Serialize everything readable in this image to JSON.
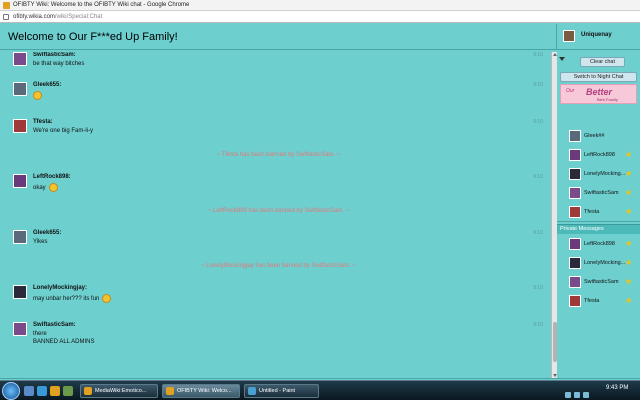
{
  "browser": {
    "window_title": "OFIBTY Wiki: Welcome to the OFIBTY Wiki chat - Google Chrome",
    "url_domain": "ofibty.wikia.com",
    "url_path": "/wiki/Special:Chat"
  },
  "chat": {
    "room_title": "Welcome to Our F***ed Up Family!",
    "current_user": "Uniquenay",
    "messages": [
      {
        "user": "SwiftasticSam:",
        "lines": [
          "be that way bitches"
        ],
        "time": "9:10",
        "avatar_color": "#7a4a8a"
      },
      {
        "user": "Gleek655:",
        "lines": [
          ""
        ],
        "time": "9:10",
        "avatar_color": "#5a6a7a",
        "emote": "smiley"
      },
      {
        "user": "Tfesta:",
        "lines": [
          "We're one big Fam-li-y"
        ],
        "time": "9:10",
        "avatar_color": "#a03a3a"
      },
      {
        "user": "LeftRock898:",
        "lines": [
          "okay"
        ],
        "time": "9:10",
        "avatar_color": "#6a3a7a",
        "emote": "smiley"
      },
      {
        "user": "Gleek655:",
        "lines": [
          "Yikes"
        ],
        "time": "9:10",
        "avatar_color": "#5a6a7a"
      },
      {
        "user": "LonelyMockingjay:",
        "lines": [
          "may unbar her??? its fun"
        ],
        "time": "9:10",
        "avatar_color": "#2a2a3a",
        "emote": "smiley"
      },
      {
        "user": "SwiftasticSam:",
        "lines": [
          "there",
          "BANNED ALL ADMINS"
        ],
        "time": "9:10",
        "avatar_color": "#7a4a8a"
      }
    ],
    "inline_alerts": [
      "~ Tfesta has been banned by SwiftasticSam. ~",
      "~ LeftRock898 has been banned by SwiftasticSam. ~",
      "~ LonelyMockingjay has been banned by SwiftasticSam. ~"
    ]
  },
  "sidebar": {
    "clear_chat_label": "Clear chat",
    "night_chat_label": "Switch to Night Chat",
    "banner": {
      "line1": "Our",
      "line2": "Better",
      "line3": "Bleh Family"
    },
    "users": [
      {
        "name": "Gleek##",
        "star": false,
        "avatar_color": "#5a6a7a"
      },
      {
        "name": "LeftRock898",
        "star": true,
        "avatar_color": "#6a3a7a"
      },
      {
        "name": "LonelyMocking...",
        "star": true,
        "avatar_color": "#2a2a3a"
      },
      {
        "name": "SwiftasticSam",
        "star": true,
        "avatar_color": "#7a4a8a"
      },
      {
        "name": "Tfesta",
        "star": true,
        "avatar_color": "#a03a3a"
      }
    ],
    "private_messages_label": "Private Messages",
    "private_users": [
      {
        "name": "LeftRock898",
        "star": true,
        "avatar_color": "#6a3a7a"
      },
      {
        "name": "LonelyMocking...",
        "star": true,
        "avatar_color": "#2a2a3a"
      },
      {
        "name": "SwiftasticSam",
        "star": true,
        "avatar_color": "#7a4a8a"
      },
      {
        "name": "Tfesta",
        "star": true,
        "avatar_color": "#a03a3a"
      }
    ]
  },
  "taskbar": {
    "tasks": [
      {
        "label": "MediaWiki:Emotico...",
        "active": false,
        "icon_color": "#e0a020"
      },
      {
        "label": "OFIBTY Wiki: Welco...",
        "active": true,
        "icon_color": "#e0a020"
      },
      {
        "label": "Untitled - Paint",
        "active": false,
        "icon_color": "#4aa0d0"
      }
    ],
    "clock": "9:43 PM"
  },
  "colors": {
    "page_bg": "#6ecfcf",
    "ban_text": "#e07a7a",
    "star": "#f5c400"
  }
}
